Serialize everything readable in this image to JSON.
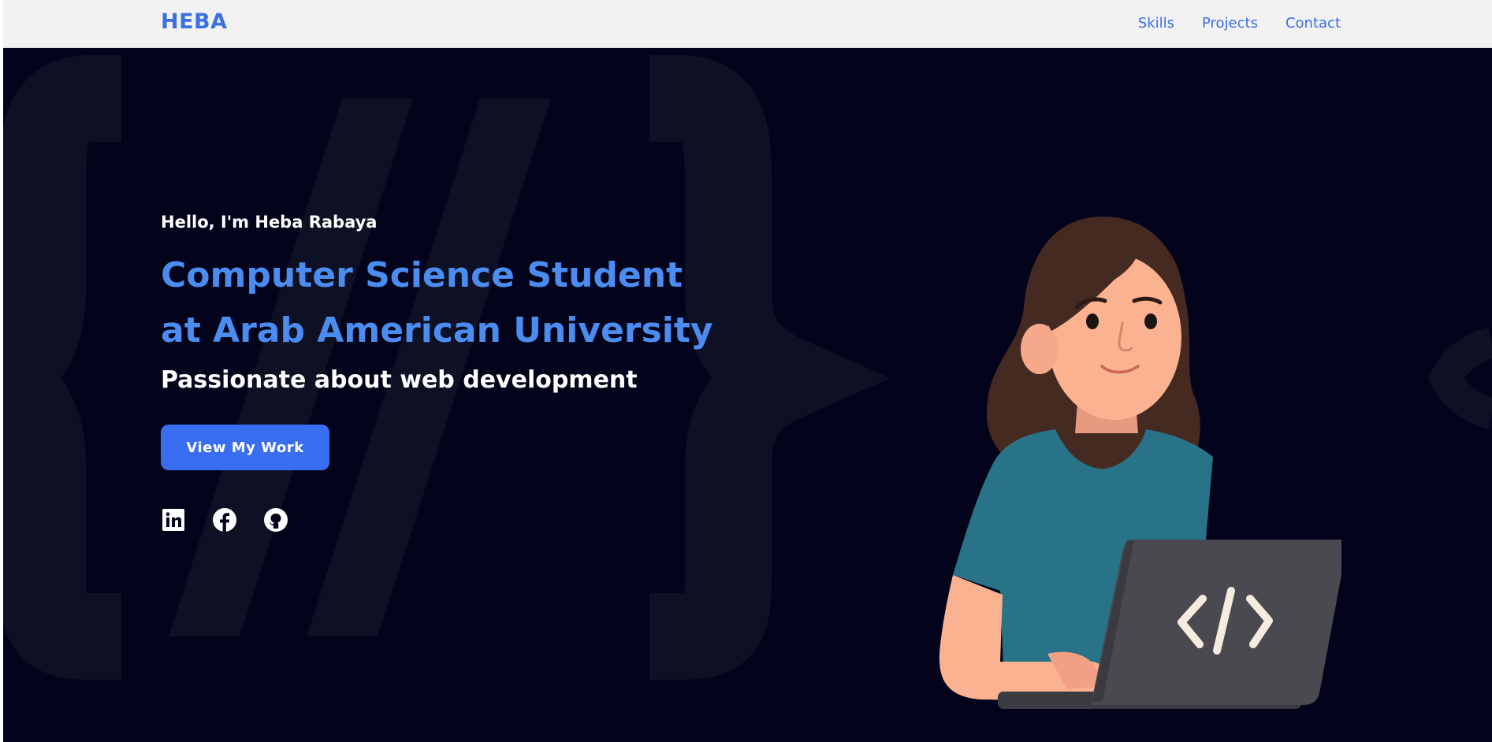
{
  "header": {
    "brand": "HEBA",
    "nav": [
      {
        "label": "Skills"
      },
      {
        "label": "Projects"
      },
      {
        "label": "Contact"
      }
    ]
  },
  "hero": {
    "greeting": "Hello, I'm Heba Rabaya",
    "headline_line1": "Computer Science Student",
    "headline_line2": "at Arab American University",
    "tagline": "Passionate about web development",
    "cta_label": "View My Work",
    "socials": [
      {
        "icon": "linkedin-icon"
      },
      {
        "icon": "facebook-icon"
      },
      {
        "icon": "github-icon"
      }
    ],
    "illustration_code_glyph": "</>"
  },
  "colors": {
    "accent": "#3b6fe4",
    "headline": "#4a8cf0",
    "button": "#3a6ef0",
    "background": "#03041c",
    "header_bg": "#f2f2f2"
  }
}
